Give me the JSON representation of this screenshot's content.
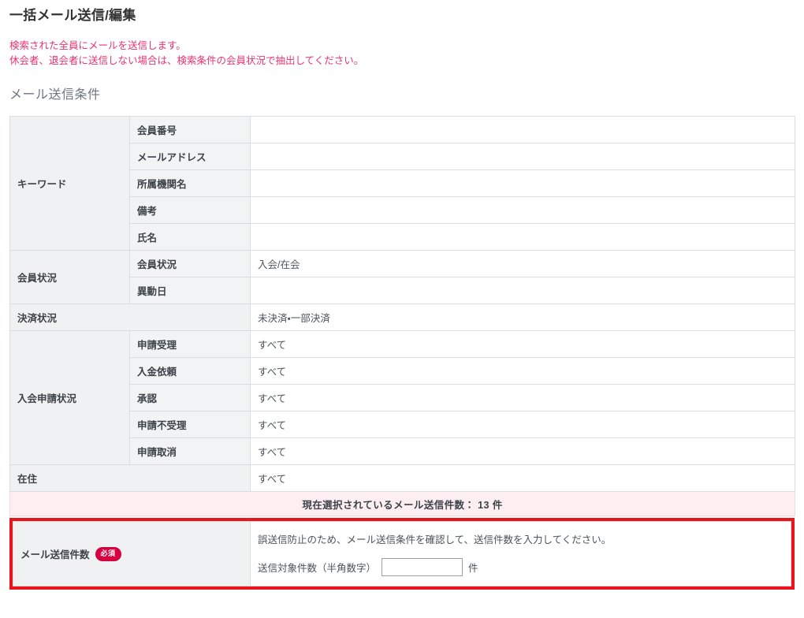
{
  "page": {
    "title": "一括メール送信/編集",
    "notice_lines": [
      "検索された全員にメールを送信します。",
      "休会者、退会者に送信しない場合は、検索条件の会員状況で抽出してください。"
    ],
    "section_title": "メール送信条件"
  },
  "conditions": {
    "groups": [
      {
        "label": "キーワード",
        "rows": [
          {
            "sublabel": "会員番号",
            "value": ""
          },
          {
            "sublabel": "メールアドレス",
            "value": ""
          },
          {
            "sublabel": "所属機関名",
            "value": ""
          },
          {
            "sublabel": "備考",
            "value": ""
          },
          {
            "sublabel": "氏名",
            "value": ""
          }
        ]
      },
      {
        "label": "会員状況",
        "rows": [
          {
            "sublabel": "会員状況",
            "value": "入会/在会"
          },
          {
            "sublabel": "異動日",
            "value": ""
          }
        ]
      },
      {
        "label": "決済状況",
        "span": true,
        "rows": [
          {
            "sublabel": "",
            "value": "未決済・一部決済"
          }
        ]
      },
      {
        "label": "入会申請状況",
        "rows": [
          {
            "sublabel": "申請受理",
            "value": "すべて"
          },
          {
            "sublabel": "入金依頼",
            "value": "すべて"
          },
          {
            "sublabel": "承認",
            "value": "すべて"
          },
          {
            "sublabel": "申請不受理",
            "value": "すべて"
          },
          {
            "sublabel": "申請取消",
            "value": "すべて"
          }
        ]
      },
      {
        "label": "在住",
        "span": true,
        "rows": [
          {
            "sublabel": "",
            "value": "すべて"
          }
        ]
      }
    ],
    "count_row_text": "現在選択されているメール送信件数： 13 件"
  },
  "required_block": {
    "label": "メール送信件数",
    "badge": "必須",
    "description": "誤送信防止のため、メール送信条件を確認して、送信件数を入力してください。",
    "input_label": "送信対象件数（半角数字）",
    "input_value": "",
    "input_suffix": "件"
  },
  "colors": {
    "notice_red": "#e8336e",
    "highlight_border": "#e8151c",
    "badge_bg": "#d50040",
    "count_row_bg": "#fdeff1",
    "label_bg": "#f0f1f2"
  }
}
